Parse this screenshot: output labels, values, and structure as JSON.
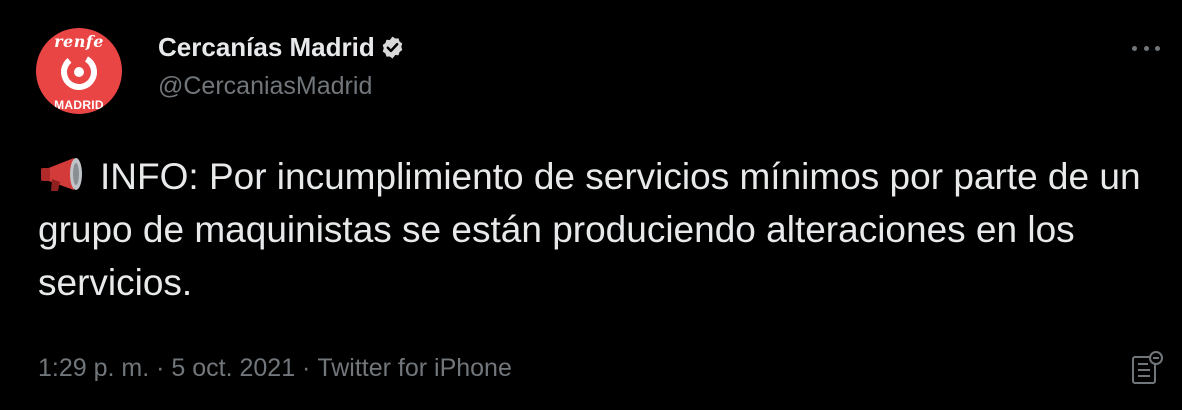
{
  "account": {
    "display_name": "Cercanías Madrid",
    "handle": "@CercaniasMadrid",
    "verified": true,
    "avatar": {
      "top_text": "renfe",
      "bottom_text": "MADRID",
      "background_color": "#e94545"
    }
  },
  "tweet": {
    "emoji": "megaphone-icon",
    "text": "INFO: Por incumplimiento de servicios mínimos por parte de un grupo de maquinistas se están produciendo alteraciones en los servicios."
  },
  "meta": {
    "time": "1:29 p. m.",
    "separator": " · ",
    "date": "5 oct. 2021",
    "source": "Twitter for iPhone"
  },
  "colors": {
    "background": "#000000",
    "primary_text": "#e7e9ea",
    "secondary_text": "#71767b",
    "verified_badge": "#d9d9d9"
  },
  "icons": {
    "more": "more-options-icon",
    "analytics": "tweet-analytics-icon"
  }
}
